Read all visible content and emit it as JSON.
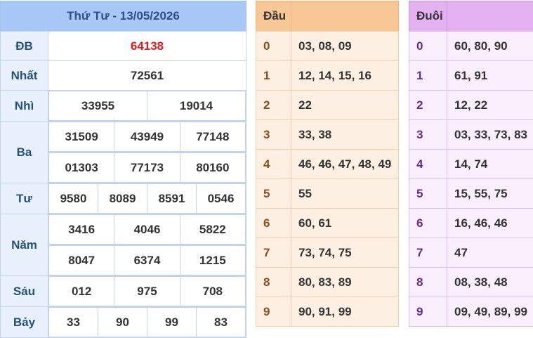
{
  "results": {
    "header": "Thứ Tư - 13/05/2026",
    "rows": [
      {
        "label": "ĐB",
        "values": [
          "64138"
        ]
      },
      {
        "label": "Nhất",
        "values": [
          "72561"
        ]
      },
      {
        "label": "Nhì",
        "values": [
          "33955",
          "19014"
        ]
      },
      {
        "label": "Ba",
        "values": [
          "31509",
          "43949",
          "77148",
          "01303",
          "77173",
          "80160"
        ]
      },
      {
        "label": "Tư",
        "values": [
          "9580",
          "8089",
          "8591",
          "0546"
        ]
      },
      {
        "label": "Năm",
        "values": [
          "3416",
          "4046",
          "5822",
          "8047",
          "6374",
          "1215"
        ]
      },
      {
        "label": "Sáu",
        "values": [
          "012",
          "975",
          "708"
        ]
      },
      {
        "label": "Bảy",
        "values": [
          "33",
          "90",
          "99",
          "83"
        ]
      }
    ]
  },
  "dau": {
    "header": "Đầu",
    "rows": [
      {
        "digit": "0",
        "values": "03, 08, 09"
      },
      {
        "digit": "1",
        "values": "12, 14, 15, 16"
      },
      {
        "digit": "2",
        "values": "22"
      },
      {
        "digit": "3",
        "values": "33, 38"
      },
      {
        "digit": "4",
        "values": "46, 46, 47, 48, 49"
      },
      {
        "digit": "5",
        "values": "55"
      },
      {
        "digit": "6",
        "values": "60, 61"
      },
      {
        "digit": "7",
        "values": "73, 74, 75"
      },
      {
        "digit": "8",
        "values": "80, 83, 89"
      },
      {
        "digit": "9",
        "values": "90, 91, 99"
      }
    ]
  },
  "duoi": {
    "header": "Đuôi",
    "rows": [
      {
        "digit": "0",
        "values": "60, 80, 90"
      },
      {
        "digit": "1",
        "values": "61, 91"
      },
      {
        "digit": "2",
        "values": "12, 22"
      },
      {
        "digit": "3",
        "values": "03, 33, 73, 83"
      },
      {
        "digit": "4",
        "values": "14, 74"
      },
      {
        "digit": "5",
        "values": "15, 55, 75"
      },
      {
        "digit": "6",
        "values": "16, 46, 46"
      },
      {
        "digit": "7",
        "values": "47"
      },
      {
        "digit": "8",
        "values": "08, 38, 48"
      },
      {
        "digit": "9",
        "values": "09, 49, 89, 99"
      }
    ]
  }
}
